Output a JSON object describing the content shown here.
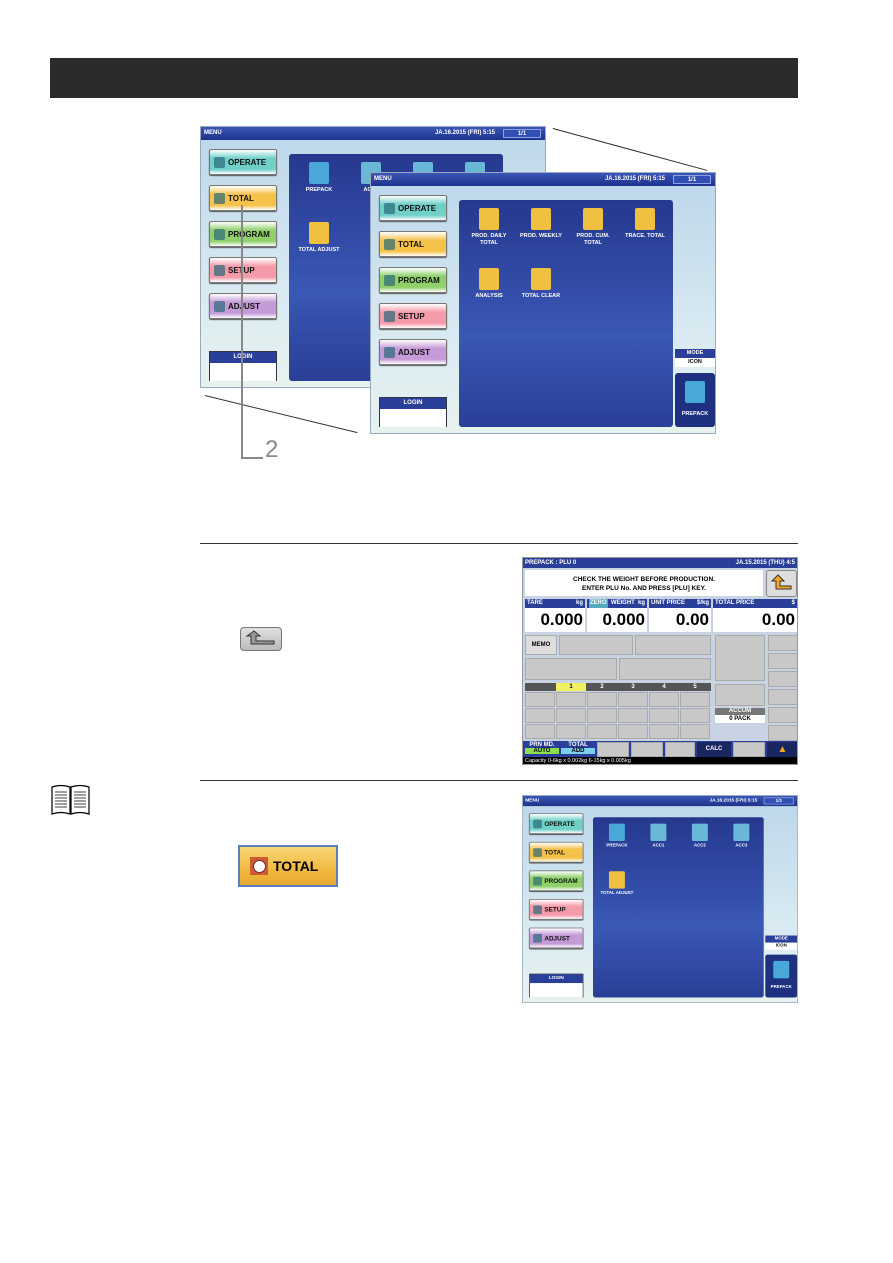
{
  "screens_menu": [
    {
      "title": "MENU",
      "datetime": "JA.16.2015 (FRI)  5:15",
      "page": "1/1",
      "buttons": [
        "OPERATE",
        "TOTAL",
        "PROGRAM",
        "SETUP",
        "ADJUST"
      ],
      "login": "LOGIN",
      "icons": [
        {
          "label": "PREPACK",
          "icon": "prepack-icon"
        },
        {
          "label": "ACC1",
          "icon": "trash-icon"
        },
        {
          "label": "ACC2",
          "icon": "trash-icon"
        },
        {
          "label": "ACC3",
          "icon": "trash-icon"
        },
        {
          "label": "TOTAL ADJUST",
          "icon": "total-adjust-icon"
        }
      ],
      "mode_label": "MODE",
      "mode_value": "ICON",
      "mode_button": "PREPACK"
    },
    {
      "title": "MENU",
      "datetime": "JA.16.2015 (FRI)  5:15",
      "page": "1/1",
      "buttons": [
        "OPERATE",
        "TOTAL",
        "PROGRAM",
        "SETUP",
        "ADJUST"
      ],
      "login": "LOGIN",
      "icons": [
        {
          "label": "PROD. DAILY TOTAL",
          "icon": "daily-report-icon"
        },
        {
          "label": "PROD. WEEKLY",
          "icon": "weekly-report-icon"
        },
        {
          "label": "PROD. CUM. TOTAL",
          "icon": "cumulative-report-icon"
        },
        {
          "label": "TRACE. TOTAL",
          "icon": "trace-icon"
        },
        {
          "label": "ANALYSIS",
          "icon": "analysis-icon"
        },
        {
          "label": "TOTAL CLEAR",
          "icon": "total-clear-icon"
        }
      ],
      "mode_label": "MODE",
      "mode_value": "ICON",
      "mode_button": "PREPACK"
    },
    {
      "title": "MENU",
      "datetime": "JA.16.2015 (FRI)  5:15",
      "page": "1/1",
      "buttons": [
        "OPERATE",
        "TOTAL",
        "PROGRAM",
        "SETUP",
        "ADJUST"
      ],
      "login": "LOGIN",
      "icons": [
        {
          "label": "PREPACK",
          "icon": "prepack-icon"
        },
        {
          "label": "ACC1",
          "icon": "trash-icon"
        },
        {
          "label": "ACC2",
          "icon": "trash-icon"
        },
        {
          "label": "ACC3",
          "icon": "trash-icon"
        },
        {
          "label": "TOTAL ADJUST",
          "icon": "total-adjust-icon"
        }
      ],
      "mode_label": "MODE",
      "mode_value": "ICON",
      "mode_button": "PREPACK"
    }
  ],
  "button_colors": [
    "#6fd0c8",
    "#f5c24a",
    "#8fd06a",
    "#f59aa8",
    "#c49ad8"
  ],
  "callout": "2",
  "plu": {
    "title": "PREPACK : PLU 0",
    "datetime": "JA.15.2015 (THU)  4:5",
    "message1": "CHECK THE WEIGHT BEFORE PRODUCTION.",
    "message2": "ENTER PLU No. AND PRESS [PLU] KEY.",
    "fields": [
      {
        "label": "TARE",
        "unit": "kg",
        "value": "0.000"
      },
      {
        "label": "WEIGHT",
        "unit": "kg",
        "value": "0.000",
        "badge": "ZERO"
      },
      {
        "label": "UNIT PRICE",
        "unit": "$/kg",
        "value": "0.00"
      },
      {
        "label": "TOTAL PRICE",
        "unit": "$",
        "value": "0.00"
      }
    ],
    "memo": "MEMO",
    "tabs": [
      "1",
      "2",
      "3",
      "4",
      "5"
    ],
    "accum_label": "ACCUM",
    "accum_value": "0 PACK",
    "prn_label": "PRN MD.",
    "prn_value": "AUTO",
    "total_label": "TOTAL",
    "total_value": "ADD",
    "calc": "CALC",
    "capacity": "Capacity 0-6kg x 0.002kg  6-15kg x 0.005kg"
  },
  "total_button": "TOTAL"
}
